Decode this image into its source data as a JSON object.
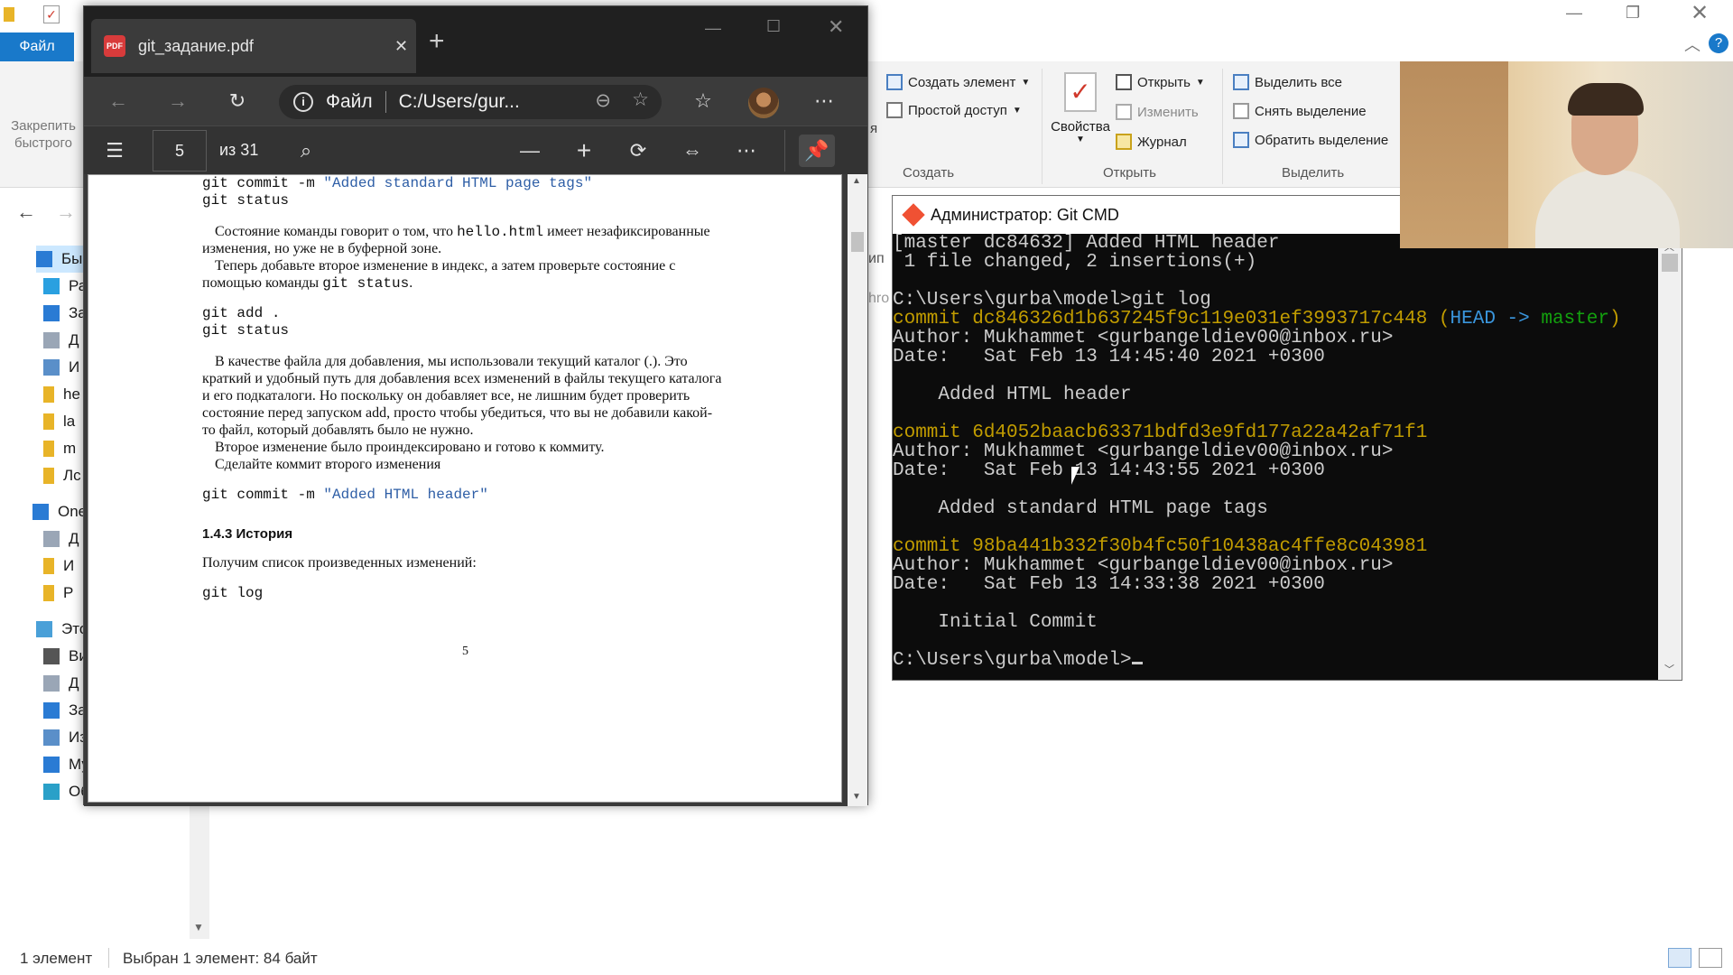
{
  "explorer": {
    "file_tab": "Файл",
    "pin_label_1": "Закрепить",
    "pin_label_2": "быстрого",
    "ribbon": {
      "create_element": "Создать элемент",
      "easy_access": "Простой доступ",
      "group_create": "Создать",
      "properties": "Свойства",
      "open": "Открыть",
      "edit": "Изменить",
      "history": "Журнал",
      "group_open": "Открыть",
      "select_all": "Выделить все",
      "select_none": "Снять выделение",
      "invert_selection": "Обратить выделение",
      "group_select": "Выделить"
    },
    "sidebar": [
      {
        "label": "Быс",
        "icon": "star-icon"
      },
      {
        "label": "Ра",
        "icon": "desktop-icon"
      },
      {
        "label": "За",
        "icon": "download-icon"
      },
      {
        "label": "Д",
        "icon": "document-icon"
      },
      {
        "label": "И",
        "icon": "picture-icon"
      },
      {
        "label": "he",
        "icon": "folder-icon"
      },
      {
        "label": "la",
        "icon": "folder-icon"
      },
      {
        "label": "m",
        "icon": "folder-icon"
      },
      {
        "label": "Лс",
        "icon": "folder-icon"
      },
      {
        "label": "One",
        "icon": "cloud-icon"
      },
      {
        "label": "Д",
        "icon": "document-icon"
      },
      {
        "label": "И",
        "icon": "folder-icon"
      },
      {
        "label": "Р",
        "icon": "folder-icon"
      },
      {
        "label": "Это",
        "icon": "computer-icon"
      },
      {
        "label": "Ви",
        "icon": "video-icon"
      },
      {
        "label": "Д",
        "icon": "document-icon"
      },
      {
        "label": "Загрузки",
        "icon": "download-icon"
      },
      {
        "label": "Изображения",
        "icon": "picture-icon"
      },
      {
        "label": "Музыка",
        "icon": "music-icon"
      },
      {
        "label": "Объемные объе",
        "icon": "cube-icon"
      }
    ],
    "partial_right_1": "ип",
    "partial_right_2": "hro",
    "partial_right_3": "я",
    "status_count": "1 элемент",
    "status_selected": "Выбран 1 элемент: 84 байт"
  },
  "edge": {
    "tab_title": "git_задание.pdf",
    "pdf_badge": "PDF",
    "address_label": "Файл",
    "address_path": "C:/Users/gur...",
    "page_number": "5",
    "page_total": "из 31",
    "pdf": {
      "l1_cmd": "git commit -m ",
      "l1_str": "\"Added standard HTML page tags\"",
      "l2": "git status",
      "p1_a1": "Состояние команды говорит о том, что ",
      "p1_code": "hello.html",
      "p1_a2": " имеет незафиксированные",
      "p1_b": "изменения, но уже не в буферной зоне.",
      "p1_c": "Теперь добавьте второе изменение в индекс, а затем проверьте состояние с",
      "p1_d1": "помощью команды ",
      "p1_dcode": "git status",
      "p1_d2": ".",
      "l3": "git add .",
      "l4": "git status",
      "p2_a": "В качестве файла для добавления, мы использовали текущий каталог (.). Это",
      "p2_b": "краткий и удобный путь для добавления всех изменений в файлы текущего каталога",
      "p2_c": "и его подкаталоги. Но поскольку он добавляет все, не лишним будет проверить",
      "p2_d": "состояние перед запуском add, просто чтобы убедиться, что вы не добавили какой-",
      "p2_e": "то файл, который добавлять было не нужно.",
      "p2_f": "Второе изменение было проиндексировано и готово к коммиту.",
      "p2_g": "Сделайте коммит второго изменения",
      "l5_cmd": "git commit -m ",
      "l5_str": "\"Added HTML header\"",
      "section": "1.4.3  История",
      "p3": "Получим список произведенных изменений:",
      "l6": "git log",
      "page_footer": "5"
    }
  },
  "cmd": {
    "title": "Администратор: Git CMD",
    "lines": {
      "l1": "[master dc84632] Added HTML header",
      "l2": " 1 file changed, 2 insertions(+)",
      "l3": "C:\\Users\\gurba\\model>git log",
      "c1": "commit dc846326d1b637245f9c119e031ef3993717c448",
      "c1_head_open": " (",
      "c1_head": "HEAD -> ",
      "c1_master": "master",
      "c1_close": ")",
      "a1": "Author: Mukhammet <gurbangeldiev00@inbox.ru>",
      "d1": "Date:   Sat Feb 13 14:45:40 2021 +0300",
      "m1": "    Added HTML header",
      "c2": "commit 6d4052baacb63371bdfd3e9fd177a22a42af71f1",
      "a2": "Author: Mukhammet <gurbangeldiev00@inbox.ru>",
      "d2": "Date:   Sat Feb 13 14:43:55 2021 +0300",
      "m2": "    Added standard HTML page tags",
      "c3": "commit 98ba441b332f30b4fc50f10438ac4ffe8c043981",
      "a3": "Author: Mukhammet <gurbangeldiev00@inbox.ru>",
      "d3": "Date:   Sat Feb 13 14:33:38 2021 +0300",
      "m3": "    Initial Commit",
      "prompt": "C:\\Users\\gurba\\model>"
    }
  },
  "colors": {
    "explorer_accent": "#1979ca",
    "terminal_bg": "#0c0c0c",
    "terminal_fg": "#cccccc",
    "commit_yellow": "#c19c00",
    "head_cyan": "#3a96dd",
    "branch_green": "#13a10e",
    "edge_dark": "#2b2b2b"
  }
}
